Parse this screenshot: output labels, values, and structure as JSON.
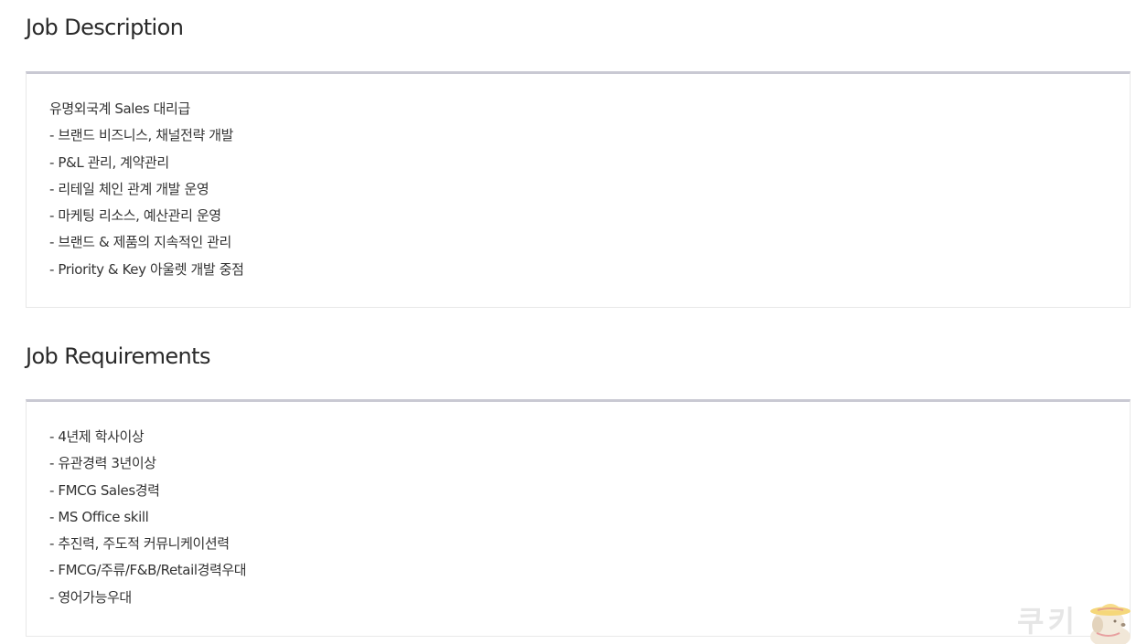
{
  "description": {
    "title": "Job Description",
    "items": [
      "유명외국계 Sales 대리급",
      "- 브랜드 비즈니스, 채널전략 개발",
      "- P&L 관리, 계약관리",
      "- 리테일 체인 관계 개발 운영",
      "- 마케팅 리소스, 예산관리 운영",
      "- 브랜드 & 제품의 지속적인 관리",
      "- Priority & Key 아울렛 개발 중점"
    ]
  },
  "requirements": {
    "title": "Job Requirements",
    "items": [
      "- 4년제 학사이상",
      "- 유관경력 3년이상",
      "- FMCG Sales경력",
      "- MS Office skill",
      "- 추진력, 주도적 커뮤니케이션력",
      "- FMCG/주류/F&B/Retail경력우대",
      "- 영어가능우대"
    ]
  },
  "watermark": {
    "text": "쿠키",
    "icon": "puppy-with-hat-icon",
    "hat_color": "#f5d77a"
  }
}
